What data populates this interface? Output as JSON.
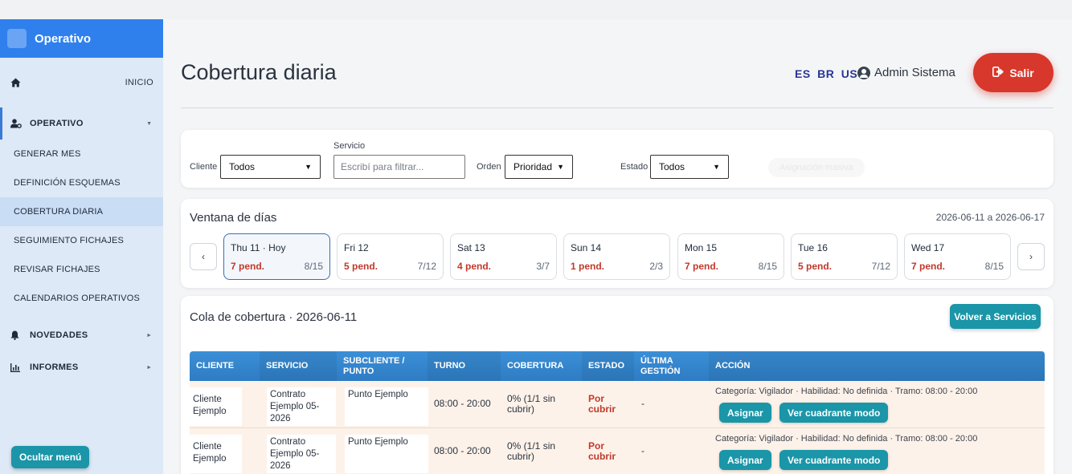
{
  "sidebar": {
    "brand": "Operativo",
    "home": "INICIO",
    "operativo": "OPERATIVO",
    "items": [
      {
        "label": "GENERAR MES"
      },
      {
        "label": "DEFINICIÓN ESQUEMAS"
      },
      {
        "label": "COBERTURA DIARIA"
      },
      {
        "label": "SEGUIMIENTO FICHAJES"
      },
      {
        "label": "REVISAR FICHAJES"
      },
      {
        "label": "CALENDARIOS OPERATIVOS"
      }
    ],
    "novedades": "NOVEDADES",
    "informes": "INFORMES",
    "hide_menu": "Ocultar menú"
  },
  "header": {
    "title": "Cobertura diaria",
    "langs": [
      "ES",
      "BR",
      "US"
    ],
    "user": "Admin Sistema",
    "logout": "Salir"
  },
  "filters": {
    "cliente_label": "Cliente",
    "cliente_value": "Todos",
    "servicio_label": "Servicio",
    "servicio_placeholder": "Escribí para filtrar...",
    "orden_label": "Orden",
    "orden_value": "Prioridad",
    "estado_label": "Estado",
    "estado_value": "Todos",
    "ghost_button": "Asignación masiva"
  },
  "days": {
    "title": "Ventana de días",
    "range": "2026-06-11 a 2026-06-17",
    "prev": "‹",
    "next": "›",
    "list": [
      {
        "name": "Thu 11 · Hoy",
        "pend": "7 pend.",
        "ratio": "8/15"
      },
      {
        "name": "Fri 12",
        "pend": "5 pend.",
        "ratio": "7/12"
      },
      {
        "name": "Sat 13",
        "pend": "4 pend.",
        "ratio": "3/7"
      },
      {
        "name": "Sun 14",
        "pend": "1 pend.",
        "ratio": "2/3"
      },
      {
        "name": "Mon 15",
        "pend": "7 pend.",
        "ratio": "8/15"
      },
      {
        "name": "Tue 16",
        "pend": "5 pend.",
        "ratio": "7/12"
      },
      {
        "name": "Wed 17",
        "pend": "7 pend.",
        "ratio": "8/15"
      }
    ]
  },
  "queue": {
    "title": "Cola de cobertura · 2026-06-11",
    "back": "Volver a Servicios",
    "headers": [
      "CLIENTE",
      "SERVICIO",
      "SUBCLIENTE / PUNTO",
      "TURNO",
      "COBERTURA",
      "ESTADO",
      "ÚLTIMA GESTIÓN",
      "ACCIÓN"
    ],
    "rows": [
      {
        "cliente": "Cliente Ejemplo",
        "servicio": "Contrato Ejemplo 05-2026",
        "punto": "Punto Ejemplo",
        "turno": "08:00 - 20:00",
        "cobertura": "0% (1/1 sin cubrir)",
        "estado": "Por cubrir",
        "gestion": "-",
        "categoria": "Categoría: Vigilador · Habilidad: No definida · Tramo: 08:00 - 20:00",
        "asignar": "Asignar",
        "ver": "Ver cuadrante modo"
      },
      {
        "cliente": "Cliente Ejemplo",
        "servicio": "Contrato Ejemplo 05-2026",
        "punto": "Punto Ejemplo",
        "turno": "08:00 - 20:00",
        "cobertura": "0% (1/1 sin cubrir)",
        "estado": "Por cubrir",
        "gestion": "-",
        "categoria": "Categoría: Vigilador · Habilidad: No definida · Tramo: 08:00 - 20:00",
        "asignar": "Asignar",
        "ver": "Ver cuadrante modo"
      }
    ]
  }
}
